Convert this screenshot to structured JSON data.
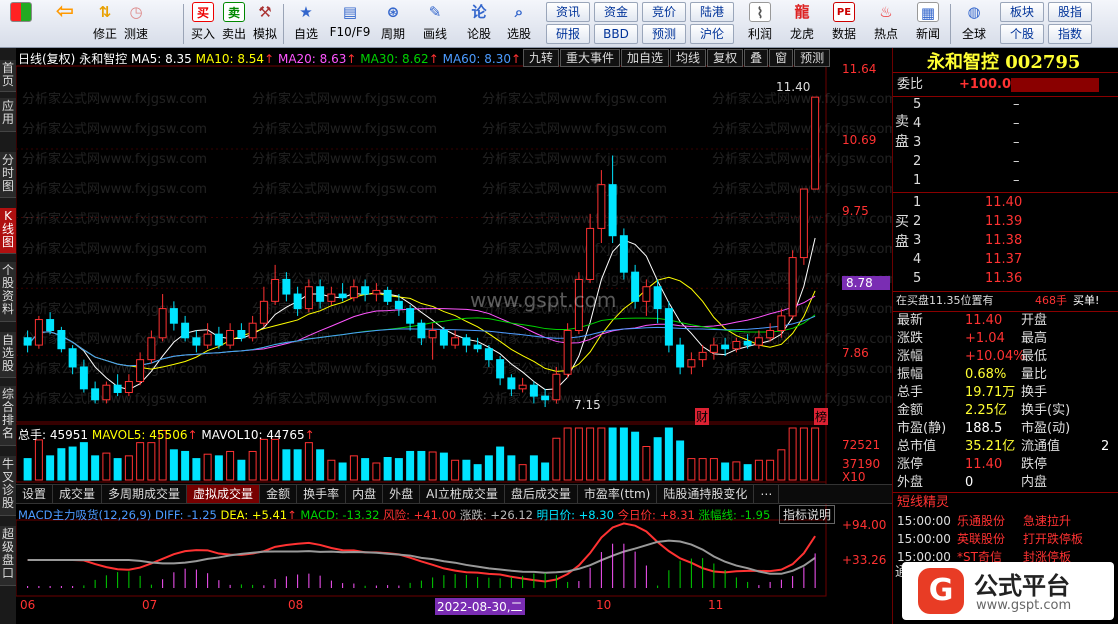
{
  "toolbar": {
    "buttons": [
      {
        "name": "color-grid-icon",
        "label": ""
      },
      {
        "name": "back-arrow-icon",
        "label": ""
      },
      {
        "name": "modify",
        "label": "修正"
      },
      {
        "name": "test-speed",
        "label": "测速"
      },
      {
        "name": "buy",
        "label": "买入"
      },
      {
        "name": "sell",
        "label": "卖出"
      },
      {
        "name": "simulate",
        "label": "模拟"
      },
      {
        "name": "self-select",
        "label": "自选"
      },
      {
        "name": "f10",
        "label": "F10/F9"
      },
      {
        "name": "period",
        "label": "周期"
      },
      {
        "name": "draw-line",
        "label": "画线"
      },
      {
        "name": "discuss",
        "label": "论股"
      },
      {
        "name": "stock-pick",
        "label": "选股"
      }
    ],
    "grid": [
      [
        "资讯",
        "资金",
        "竞价",
        "陆港"
      ],
      [
        "研报",
        "BBD",
        "预测",
        "沪伦"
      ]
    ],
    "right_buttons": [
      {
        "name": "profit",
        "label": "利润"
      },
      {
        "name": "dragon-tiger",
        "label": "龙虎"
      },
      {
        "name": "data",
        "label": "数据"
      },
      {
        "name": "hot-spot",
        "label": "热点"
      },
      {
        "name": "news",
        "label": "新闻"
      },
      {
        "name": "global",
        "label": "全球"
      }
    ],
    "grid2": [
      [
        "板块",
        "股指"
      ],
      [
        "个股",
        "指数"
      ]
    ]
  },
  "left_tabs": [
    "首页",
    "应用",
    "分时图",
    "K线图",
    "个股资料",
    "自选股",
    "综合排名",
    "牛叉诊股",
    "超级盘口"
  ],
  "chart_header": {
    "period": "日线(复权)",
    "stock": "永和智控",
    "ma5": "MA5: 8.35",
    "ma10": "MA10: 8.54",
    "ma20": "MA20: 8.63",
    "ma30": "MA30: 8.62",
    "ma60": "MA60: 8.30"
  },
  "chart_buttons": [
    "九转",
    "重大事件",
    "加自选",
    "均线",
    "复权",
    "叠",
    "窗",
    "预测"
  ],
  "price_axis": [
    "11.64",
    "10.69",
    "9.75",
    "8.78",
    "7.86"
  ],
  "current_price_tag": "8.78",
  "annotations": {
    "high": "11.40",
    "low": "7.15",
    "cai": "财",
    "bang": "榜"
  },
  "watermarks": {
    "text": "分析家公式网www.fxjgsw.com",
    "center": "www.gspt.com"
  },
  "volume_header": {
    "total": "总手: 45951",
    "mavol5": "MAVOL5: 45506",
    "mavol10": "MAVOL10: 44765"
  },
  "volume_axis": [
    "72521",
    "37190",
    "X10"
  ],
  "indicator_tabs": [
    "设置",
    "成交量",
    "多周期成交量",
    "虚拟成交量",
    "金额",
    "换手率",
    "内盘",
    "外盘",
    "AI立桩成交量",
    "盘后成交量",
    "市盈率(ttm)",
    "陆股通持股变化",
    "⋯"
  ],
  "active_indicator_tab": "虚拟成交量",
  "macd_header": {
    "name": "MACD主力吸货(12,26,9)",
    "diff": "DIFF: -1.25",
    "dea": "DEA: +5.41",
    "macd": "MACD: -13.32",
    "risk": "风险: +41.00",
    "rise": "涨跌: +26.12",
    "tomorrow": "明日价: +8.30",
    "today": "今日价: +8.31",
    "amp": "涨幅线: -1.95",
    "explain": "指标说明"
  },
  "macd_axis": [
    "+94.00",
    "+33.26"
  ],
  "date_axis": [
    "06",
    "07",
    "08",
    "2022-08-30,二",
    "10",
    "11"
  ],
  "right_panel": {
    "title": "永和智控 002795",
    "weibi_label": "委比",
    "weibi_value": "+100.00%",
    "sell_label": "卖盘",
    "buy_label": "买盘",
    "sells": [
      {
        "lvl": "5",
        "p": "–"
      },
      {
        "lvl": "4",
        "p": "–"
      },
      {
        "lvl": "3",
        "p": "–"
      },
      {
        "lvl": "2",
        "p": "–"
      },
      {
        "lvl": "1",
        "p": "–"
      }
    ],
    "buys": [
      {
        "lvl": "1",
        "p": "11.40"
      },
      {
        "lvl": "2",
        "p": "11.39"
      },
      {
        "lvl": "3",
        "p": "11.38"
      },
      {
        "lvl": "4",
        "p": "11.37"
      },
      {
        "lvl": "5",
        "p": "11.36"
      }
    ],
    "buy_info": "在买盘11.35位置有",
    "buy_info_qty": "468手",
    "buy_info_tag": "买单!",
    "stats": [
      {
        "k1": "最新",
        "v1": "11.40",
        "k2": "开盘",
        "v2": ""
      },
      {
        "k1": "涨跌",
        "v1": "+1.04",
        "k2": "最高",
        "v2": ""
      },
      {
        "k1": "涨幅",
        "v1": "+10.04%",
        "k2": "最低",
        "v2": ""
      },
      {
        "k1": "振幅",
        "v1": "0.68%",
        "k2": "量比",
        "v2": ""
      },
      {
        "k1": "总手",
        "v1": "19.71万",
        "k2": "换手",
        "v2": ""
      },
      {
        "k1": "金额",
        "v1": "2.25亿",
        "k2": "换手(实)",
        "v2": ""
      },
      {
        "k1": "市盈(静)",
        "v1": "188.5",
        "k2": "市盈(动)",
        "v2": ""
      },
      {
        "k1": "总市值",
        "v1": "35.21亿",
        "k2": "流通值",
        "v2": "2"
      },
      {
        "k1": "涨停",
        "v1": "11.40",
        "k2": "跌停",
        "v2": ""
      },
      {
        "k1": "外盘",
        "v1": "0",
        "k2": "内盘",
        "v2": ""
      }
    ],
    "sprite_title": "短线精灵",
    "sprites": [
      {
        "t": "15:00:00",
        "n": "乐通股份",
        "e": "急速拉升"
      },
      {
        "t": "15:00:00",
        "n": "英联股份",
        "e": "打开跌停板"
      },
      {
        "t": "15:00:00",
        "n": "*ST奇信",
        "e": "封涨停板"
      }
    ],
    "tong": "通"
  },
  "logo": {
    "mark": "G",
    "big": "公式平台",
    "small": "www.gspt.com"
  },
  "chart_data": {
    "type": "candlestick",
    "series_kline": [
      [
        8.1,
        8.0,
        8.2,
        7.9
      ],
      [
        8.0,
        8.35,
        8.4,
        7.95
      ],
      [
        8.35,
        8.2,
        8.45,
        8.15
      ],
      [
        8.2,
        7.95,
        8.25,
        7.9
      ],
      [
        7.95,
        7.7,
        8.0,
        7.6
      ],
      [
        7.7,
        7.4,
        7.8,
        7.35
      ],
      [
        7.4,
        7.25,
        7.5,
        7.2
      ],
      [
        7.25,
        7.45,
        7.5,
        7.2
      ],
      [
        7.45,
        7.35,
        7.6,
        7.3
      ],
      [
        7.35,
        7.5,
        7.6,
        7.3
      ],
      [
        7.5,
        7.8,
        7.9,
        7.45
      ],
      [
        7.8,
        8.1,
        8.2,
        7.75
      ],
      [
        8.1,
        8.5,
        8.7,
        8.05
      ],
      [
        8.5,
        8.3,
        8.6,
        8.2
      ],
      [
        8.3,
        8.1,
        8.4,
        8.05
      ],
      [
        8.1,
        8.0,
        8.2,
        7.9
      ],
      [
        8.0,
        8.15,
        8.3,
        7.95
      ],
      [
        8.15,
        8.0,
        8.25,
        7.95
      ],
      [
        8.0,
        8.2,
        8.3,
        7.95
      ],
      [
        8.2,
        8.1,
        8.3,
        8.05
      ],
      [
        8.1,
        8.3,
        8.4,
        8.05
      ],
      [
        8.3,
        8.6,
        8.8,
        8.25
      ],
      [
        8.6,
        8.9,
        9.1,
        8.55
      ],
      [
        8.9,
        8.7,
        9.0,
        8.6
      ],
      [
        8.7,
        8.5,
        8.8,
        8.4
      ],
      [
        8.5,
        8.8,
        8.9,
        8.45
      ],
      [
        8.8,
        8.6,
        8.9,
        8.5
      ],
      [
        8.6,
        8.7,
        8.8,
        8.55
      ],
      [
        8.7,
        8.65,
        8.85,
        8.6
      ],
      [
        8.65,
        8.8,
        8.9,
        8.6
      ],
      [
        8.8,
        8.7,
        8.9,
        8.6
      ],
      [
        8.7,
        8.75,
        8.85,
        8.6
      ],
      [
        8.75,
        8.6,
        8.8,
        8.55
      ],
      [
        8.6,
        8.5,
        8.7,
        8.4
      ],
      [
        8.5,
        8.3,
        8.55,
        8.2
      ],
      [
        8.3,
        8.1,
        8.35,
        8.0
      ],
      [
        8.1,
        8.2,
        8.3,
        7.8
      ],
      [
        8.2,
        8.0,
        8.25,
        7.95
      ],
      [
        8.0,
        8.1,
        8.2,
        7.95
      ],
      [
        8.1,
        8.0,
        8.15,
        7.9
      ],
      [
        8.0,
        7.95,
        8.1,
        7.9
      ],
      [
        7.95,
        7.8,
        8.0,
        7.7
      ],
      [
        7.8,
        7.55,
        7.85,
        7.45
      ],
      [
        7.55,
        7.4,
        7.6,
        7.3
      ],
      [
        7.4,
        7.45,
        7.55,
        7.35
      ],
      [
        7.45,
        7.3,
        7.5,
        7.2
      ],
      [
        7.3,
        7.25,
        7.4,
        7.15
      ],
      [
        7.25,
        7.6,
        7.7,
        7.2
      ],
      [
        7.6,
        8.2,
        8.3,
        7.55
      ],
      [
        8.2,
        8.9,
        9.0,
        8.15
      ],
      [
        8.9,
        9.6,
        9.8,
        8.85
      ],
      [
        9.6,
        10.2,
        10.4,
        9.4
      ],
      [
        10.2,
        9.5,
        10.6,
        9.4
      ],
      [
        9.5,
        9.0,
        9.6,
        8.9
      ],
      [
        9.0,
        8.6,
        9.1,
        8.5
      ],
      [
        8.6,
        8.8,
        8.9,
        8.4
      ],
      [
        8.8,
        8.5,
        8.9,
        8.3
      ],
      [
        8.5,
        8.0,
        8.6,
        7.9
      ],
      [
        8.0,
        7.7,
        8.1,
        7.6
      ],
      [
        7.7,
        7.8,
        7.9,
        7.6
      ],
      [
        7.8,
        7.9,
        8.0,
        7.7
      ],
      [
        7.9,
        8.0,
        8.1,
        7.8
      ],
      [
        8.0,
        7.95,
        8.1,
        7.85
      ],
      [
        7.95,
        8.05,
        8.1,
        7.9
      ],
      [
        8.05,
        8.0,
        8.15,
        7.95
      ],
      [
        8.0,
        8.1,
        8.2,
        7.95
      ],
      [
        8.1,
        8.2,
        8.3,
        8.05
      ],
      [
        8.2,
        8.4,
        8.5,
        8.1
      ],
      [
        8.4,
        9.2,
        9.3,
        8.35
      ],
      [
        9.2,
        10.14,
        10.14,
        9.1
      ],
      [
        10.14,
        11.4,
        11.4,
        10.2
      ]
    ],
    "ylim": [
      7.0,
      11.8
    ]
  }
}
